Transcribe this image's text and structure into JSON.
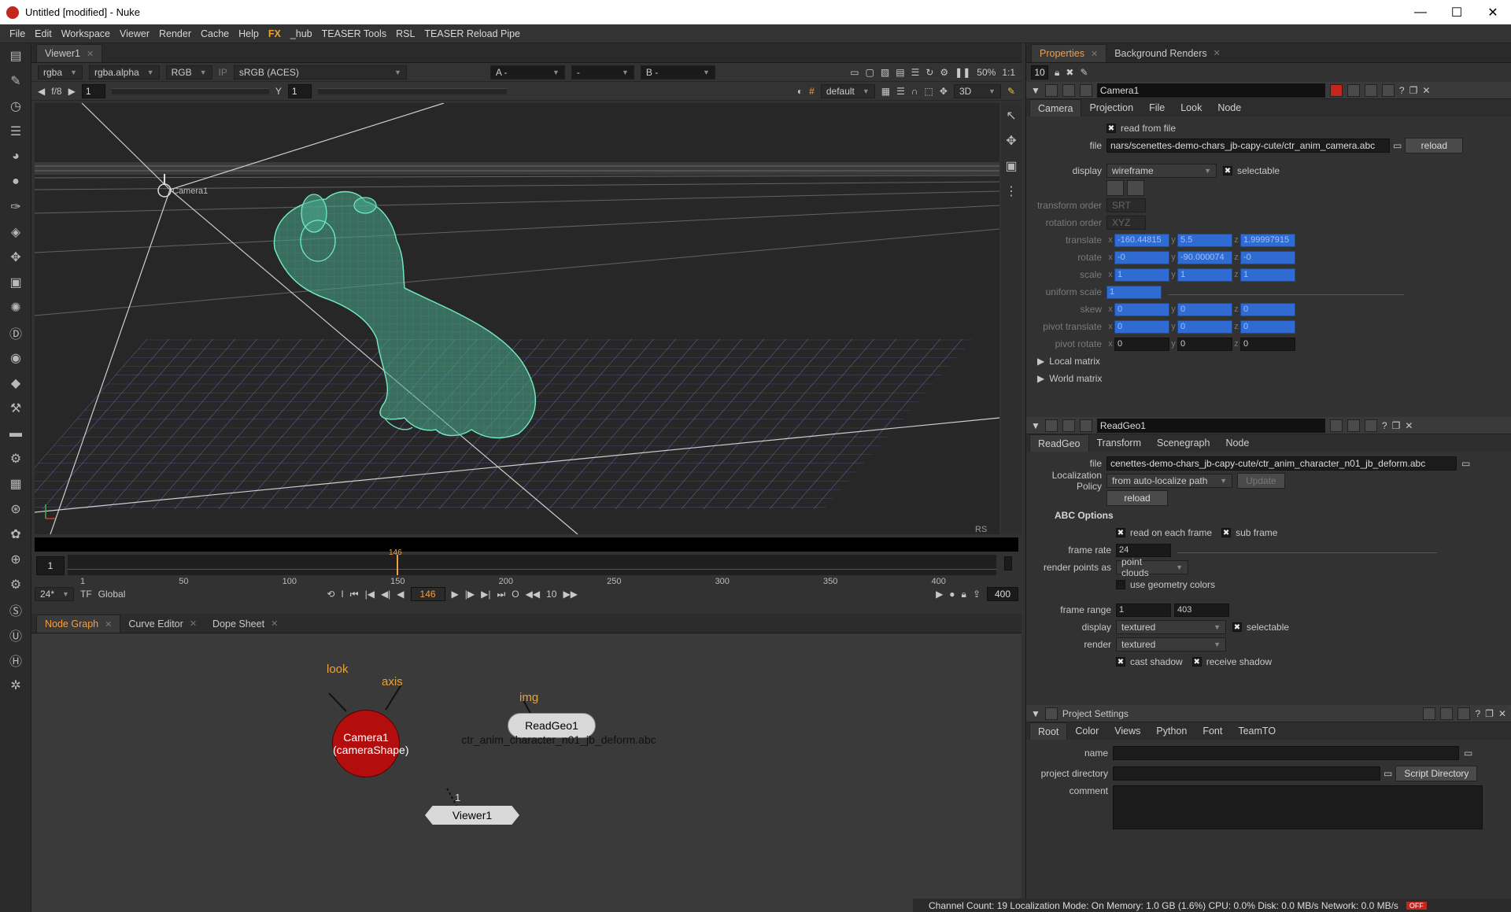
{
  "window": {
    "title": "Untitled [modified] - Nuke",
    "min": "—",
    "max": "☐",
    "close": "✕"
  },
  "menu": [
    "File",
    "Edit",
    "Workspace",
    "Viewer",
    "Render",
    "Cache",
    "Help",
    "FX",
    "_hub",
    "TEASER Tools",
    "RSL",
    "TEASER Reload Pipe"
  ],
  "viewer": {
    "tab": "Viewer1",
    "channels": "rgba",
    "alpha": "rgba.alpha",
    "rgb": "RGB",
    "ip": "IP",
    "colorspace": "sRGB (ACES)",
    "input_a": "A -",
    "input_mid": "-",
    "input_b": "B -",
    "zoom": "50%",
    "ratio": "1:1",
    "fstop": "f/8",
    "gain": "1",
    "y_label": "Y",
    "gamma": "1",
    "lut": "default",
    "mode3d": "3D",
    "camera_label": "Camera1",
    "corner_label": "RS",
    "frame_start": "1",
    "frame_end": "400",
    "frame_end2": "400",
    "current_frame": "146",
    "marker_frame": "146",
    "fps": "24*",
    "tf": "TF",
    "global": "Global",
    "step": "10",
    "ticks": [
      "1",
      "50",
      "100",
      "150",
      "200",
      "250",
      "300",
      "350",
      "400"
    ]
  },
  "nodegraph": {
    "tabs": [
      "Node Graph",
      "Curve Editor",
      "Dope Sheet"
    ],
    "camera": {
      "name": "Camera1",
      "sub": "(cameraShape)",
      "look": "look",
      "axis": "axis",
      "color": "#b40d0d"
    },
    "readgeo": {
      "name": "ReadGeo1",
      "file": "ctr_anim_character_n01_jb_deform.abc",
      "img": "img"
    },
    "viewer": {
      "name": "Viewer1",
      "input": "1"
    }
  },
  "properties": {
    "tabs": [
      "Properties",
      "Background Renders"
    ],
    "max_panels": "10",
    "camera": {
      "name": "Camera1",
      "tabs": [
        "Camera",
        "Projection",
        "File",
        "Look",
        "Node"
      ],
      "read_from_file": "read from file",
      "file_label": "file",
      "file": "nars/scenettes-demo-chars_jb-capy-cute/ctr_anim_camera.abc",
      "reload": "reload",
      "display_label": "display",
      "display": "wireframe",
      "selectable": "selectable",
      "transform_order_label": "transform order",
      "transform_order": "SRT",
      "rotation_order_label": "rotation order",
      "rotation_order": "XYZ",
      "translate_label": "translate",
      "translate": [
        "-160.44815",
        "5.5",
        "1.99997915"
      ],
      "rotate_label": "rotate",
      "rotate": [
        "-0",
        "-90.000074",
        "-0"
      ],
      "scale_label": "scale",
      "scale": [
        "1",
        "1",
        "1"
      ],
      "uniform_scale_label": "uniform scale",
      "uniform_scale": "1",
      "uniform_ticks": [
        "0.01",
        "0.02",
        "0.05",
        "0.1",
        "0.2",
        "0.5",
        "1",
        "2",
        "3",
        "5",
        "10"
      ],
      "skew_label": "skew",
      "skew": [
        "0",
        "0",
        "0"
      ],
      "pivot_translate_label": "pivot translate",
      "pivot_translate": [
        "0",
        "0",
        "0"
      ],
      "pivot_rotate_label": "pivot rotate",
      "pivot_rotate": [
        "0",
        "0",
        "0"
      ],
      "local_matrix": "Local matrix",
      "world_matrix": "World matrix"
    },
    "readgeo": {
      "name": "ReadGeo1",
      "tabs": [
        "ReadGeo",
        "Transform",
        "Scenegraph",
        "Node"
      ],
      "file_label": "file",
      "file": "cenettes-demo-chars_jb-capy-cute/ctr_anim_character_n01_jb_deform.abc",
      "localization_label": "Localization Policy",
      "localization": "from auto-localize path",
      "update": "Update",
      "reload": "reload",
      "abc_options": "ABC Options",
      "read_each_frame": "read on each frame",
      "sub_frame": "sub frame",
      "frame_rate_label": "frame rate",
      "frame_rate": "24",
      "frame_rate_ticks": [
        "1",
        "2",
        "3",
        "4",
        "5",
        "10",
        "20",
        "30",
        "40",
        "50",
        "100"
      ],
      "render_points_label": "render points as",
      "render_points": "point clouds",
      "use_geo_colors": "use geometry colors",
      "frame_range_label": "frame range",
      "frame_range": [
        "1",
        "403"
      ],
      "display_label": "display",
      "display": "textured",
      "selectable": "selectable",
      "render_label": "render",
      "render": "textured",
      "cast_shadow": "cast shadow",
      "receive_shadow": "receive shadow"
    },
    "project": {
      "title": "Project Settings",
      "tabs": [
        "Root",
        "Color",
        "Views",
        "Python",
        "Font",
        "TeamTO"
      ],
      "name_label": "name",
      "dir_label": "project directory",
      "script_dir": "Script Directory",
      "comment_label": "comment"
    }
  },
  "status": {
    "text": "Channel Count: 19  Localization Mode: On  Memory: 1.0 GB (1.6%)  CPU: 0.0%  Disk: 0.0 MB/s  Network: 0.0 MB/s",
    "badge": "OFF"
  },
  "colors": {
    "accent": "#f0a043",
    "wire": "#6fe8c0",
    "camera_node": "#b40d0d",
    "grid": "#7a76d6"
  }
}
